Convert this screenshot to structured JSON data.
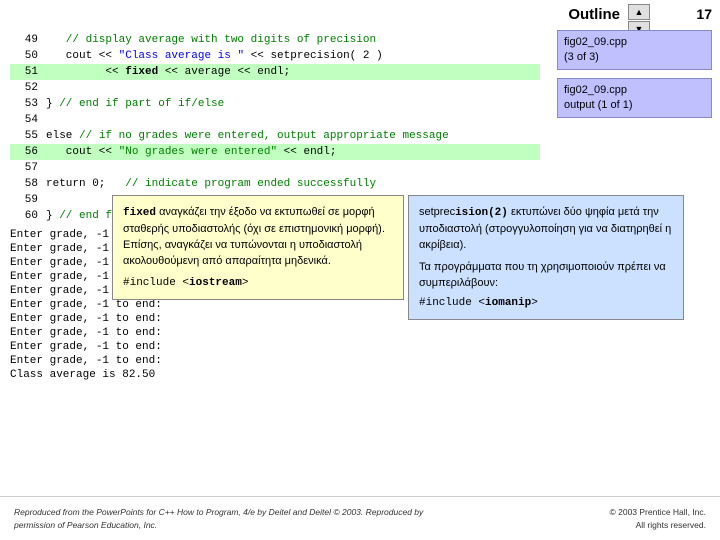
{
  "slide_number": "17",
  "outline_label": "Outline",
  "nav_up": "▲",
  "nav_down": "▼",
  "right_panel": {
    "box1_line1": "fig02_09.cpp",
    "box1_line2": "(3 of 3)",
    "box2_line1": "fig02_09.cpp",
    "box2_line2": "output (1 of 1)"
  },
  "code_lines": [
    {
      "num": "49",
      "text": "   // display average with two digits of precision",
      "type": "comment"
    },
    {
      "num": "50",
      "text": "   cout << \"Class average is \" << setprecision( 2 )",
      "type": "mixed"
    },
    {
      "num": "51",
      "text": "         << fixed << average << endl;",
      "type": "mixed"
    },
    {
      "num": "52",
      "text": "",
      "type": "empty"
    },
    {
      "num": "53",
      "text": "} // end if part of if/else",
      "type": "comment_end"
    },
    {
      "num": "54",
      "text": "",
      "type": "empty"
    },
    {
      "num": "55",
      "text": "else // if no grades were entered, output appropriate message",
      "type": "else_comment"
    },
    {
      "num": "56",
      "text": "   cout << \"No grades were entered\" << endl;",
      "type": "cout_green"
    },
    {
      "num": "57",
      "text": "",
      "type": "empty"
    },
    {
      "num": "58",
      "text": "return 0;   // indicate program ended successfully",
      "type": "return_comment"
    },
    {
      "num": "59",
      "text": "",
      "type": "empty"
    },
    {
      "num": "60",
      "text": "} // end function main",
      "type": "brace_comment"
    }
  ],
  "output_lines": [
    "Enter grade, -1 to end:",
    "Enter grade, -1 to end:",
    "Enter grade, -1 to end:",
    "Enter grade, -1 to end:",
    "Enter grade, -1 to end:",
    "Enter grade, -1 to end:",
    "Enter grade, -1 to end:",
    "Enter grade, -1 to end:",
    "Enter grade, -1 to end:",
    "Enter grade, -1 to end:",
    "Class average is 82.50"
  ],
  "tooltip_left": {
    "bold_word": "fixed",
    "text1": " αναγκάζει την έξοδο να εκτυπωθεί σε μορφή σταθερής υποδιαστολής (όχι σε επιστημονική μορφή). Επίσης, αναγκάζει να τυπώνονται η υποδιαστολή ακολουθούμενη από απαραίτητα μηδενικά.",
    "include_line": "#include <iostream>"
  },
  "tooltip_right": {
    "bold_word": "ision(2)",
    "prefix": "setprec",
    "text1": " εκτυπώνει δύο ψηφία μετά την υποδιαστολή (στρογγυλοποίηση για να διατηρηθεί η ακρίβεια).",
    "text2": "Τα προγράμματα που τη χρησιμοποιούν πρέπει να συμπεριλάβουν:",
    "include_line": "#include <iomanip>"
  },
  "bottom": {
    "left_text": "Reproduced from the PowerPoints for C++ How to Program, 4/e by Deitel and Deitel © 2003. Reproduced by permission of Pearson Education, Inc.",
    "right_line1": "© 2003 Prentice Hall, Inc.",
    "right_line2": "All rights reserved."
  }
}
